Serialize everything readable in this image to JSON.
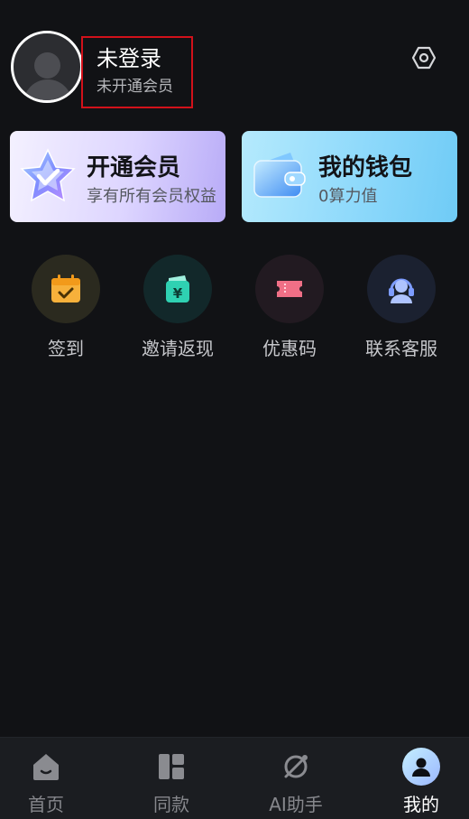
{
  "profile": {
    "title": "未登录",
    "subtitle": "未开通会员",
    "avatar_icon": "default-user-avatar",
    "settings_icon": "hexagon-settings-icon"
  },
  "cards": {
    "vip": {
      "title": "开通会员",
      "subtitle": "享有所有会员权益",
      "icon": "crystal-star-icon"
    },
    "wallet": {
      "title": "我的钱包",
      "subtitle": "0算力值",
      "icon": "wallet-icon"
    }
  },
  "shortcuts": [
    {
      "label": "签到",
      "icon": "calendar-check-icon",
      "color": "#f7b13b"
    },
    {
      "label": "邀请返现",
      "icon": "money-bag-icon",
      "color": "#2fd1b2"
    },
    {
      "label": "优惠码",
      "icon": "ticket-icon",
      "color": "#f06f86"
    },
    {
      "label": "联系客服",
      "icon": "headset-icon",
      "color": "#7d9cff"
    }
  ],
  "tabbar": {
    "tabs": [
      {
        "label": "首页",
        "icon": "home-icon"
      },
      {
        "label": "同款",
        "icon": "layout-grid-icon"
      },
      {
        "label": "AI助手",
        "icon": "compass-slash-icon"
      },
      {
        "label": "我的",
        "icon": "profile-avatar-icon"
      }
    ],
    "active_index": 3
  }
}
